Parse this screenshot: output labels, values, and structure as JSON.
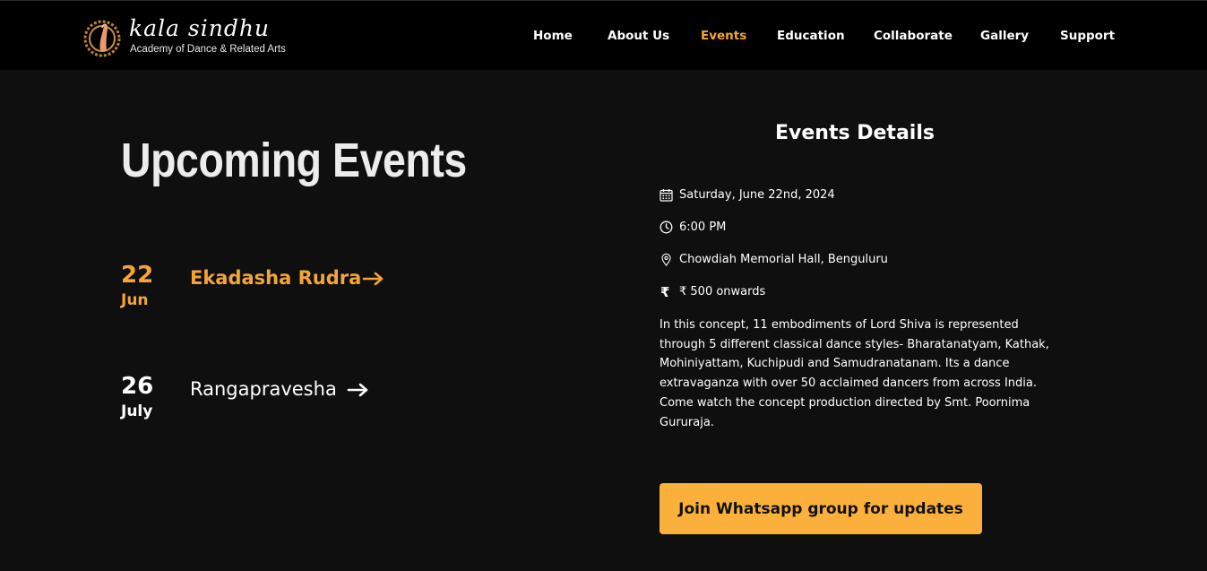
{
  "brand": {
    "name": "kala sindhu",
    "tagline": "Academy of Dance & Related Arts"
  },
  "nav": {
    "items": [
      {
        "label": "Home",
        "active": false
      },
      {
        "label": "About Us",
        "active": false
      },
      {
        "label": "Events",
        "active": true
      },
      {
        "label": "Education",
        "active": false
      },
      {
        "label": "Collaborate",
        "active": false
      },
      {
        "label": "Gallery",
        "active": false
      },
      {
        "label": "Support",
        "active": false
      }
    ]
  },
  "upcoming": {
    "title": "Upcoming Events",
    "events": [
      {
        "day": "22",
        "month": "Jun",
        "name": "Ekadasha Rudra",
        "selected": true
      },
      {
        "day": "26",
        "month": "July",
        "name": "Rangapravesha",
        "selected": false
      }
    ]
  },
  "details": {
    "title": "Events Details",
    "date": "Saturday, June 22nd, 2024",
    "time": "6:00 PM",
    "venue": "Chowdiah Memorial Hall, Benguluru",
    "price": "₹ 500 onwards",
    "description": "In this concept, 11 embodiments of Lord Shiva is represented through 5 different classical dance styles- Bharatanatyam, Kathak, Mohiniyattam, Kuchipudi and Samudranatanam. Its a dance extravaganza with over 50 acclaimed dancers from across India. Come watch the concept production directed by Smt. Poornima Gururaja.",
    "cta_label": "Join Whatsapp group for updates",
    "icons": {
      "date": "calendar-icon",
      "time": "clock-icon",
      "venue": "map-pin-icon",
      "price": "rupee-icon"
    }
  },
  "colors": {
    "accent": "#f5a437",
    "button": "#fbb03b",
    "background": "#0f0f0f",
    "header": "#000000"
  }
}
